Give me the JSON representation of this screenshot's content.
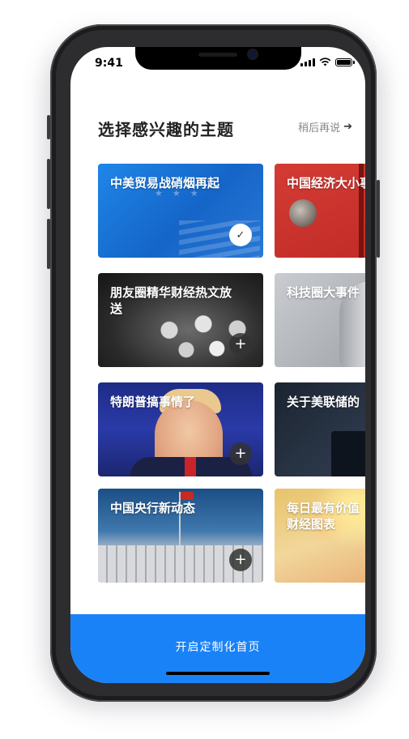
{
  "status_bar": {
    "time": "9:41",
    "icons": [
      "signal-icon",
      "wifi-icon",
      "battery-icon"
    ]
  },
  "header": {
    "title": "选择感兴趣的主题",
    "skip_label": "稍后再说",
    "skip_icon": "arrow-right-icon"
  },
  "topics": [
    {
      "label": "中美贸易战硝烟再起",
      "state": "selected",
      "badge": "✓"
    },
    {
      "label": "中国经济大小事",
      "state": "unselected",
      "badge": ""
    },
    {
      "label": "朋友圈精华财经热文放送",
      "state": "unselected",
      "badge": "+"
    },
    {
      "label": "科技圈大事件",
      "state": "unselected",
      "badge": ""
    },
    {
      "label": "特朗普搞事情了",
      "state": "unselected",
      "badge": "+"
    },
    {
      "label": "关于美联储的",
      "state": "unselected",
      "badge": ""
    },
    {
      "label": "中国央行新动态",
      "state": "unselected",
      "badge": "+"
    },
    {
      "label": "每日最有价值财经图表",
      "state": "unselected",
      "badge": ""
    }
  ],
  "footer": {
    "cta_label": "开启定制化首页"
  },
  "colors": {
    "primary": "#1a82f7",
    "title": "#222222",
    "muted": "#888888"
  }
}
